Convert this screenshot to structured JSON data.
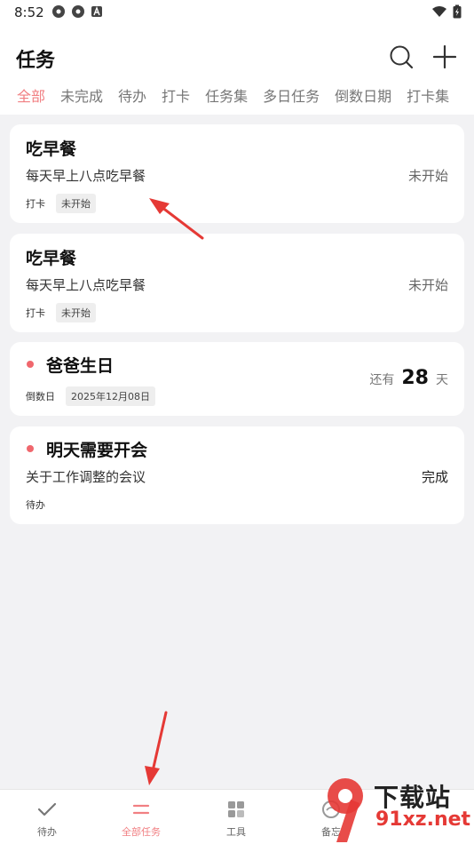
{
  "status_bar": {
    "time": "8:52"
  },
  "header": {
    "title": "任务",
    "search_icon": "search-icon",
    "add_icon": "plus-icon"
  },
  "tabs": [
    {
      "label": "全部",
      "active": true
    },
    {
      "label": "未完成",
      "active": false
    },
    {
      "label": "待办",
      "active": false
    },
    {
      "label": "打卡",
      "active": false
    },
    {
      "label": "任务集",
      "active": false
    },
    {
      "label": "多日任务",
      "active": false
    },
    {
      "label": "倒数日期",
      "active": false
    },
    {
      "label": "打卡集",
      "active": false
    }
  ],
  "cards": [
    {
      "title": "吃早餐",
      "desc": "每天早上八点吃早餐",
      "status": "未开始",
      "type_tag": "打卡",
      "state_tag": "未开始"
    },
    {
      "title": "吃早餐",
      "desc": "每天早上八点吃早餐",
      "status": "未开始",
      "type_tag": "打卡",
      "state_tag": "未开始"
    },
    {
      "title": "爸爸生日",
      "type_tag": "倒数日",
      "date_tag": "2025年12月08日",
      "countdown_prefix": "还有",
      "countdown_value": "28",
      "countdown_unit": "天"
    },
    {
      "title": "明天需要开会",
      "desc": "关于工作调整的会议",
      "status": "完成",
      "type_tag": "待办"
    }
  ],
  "bottom_nav": [
    {
      "label": "待办",
      "icon": "check-icon",
      "active": false
    },
    {
      "label": "全部任务",
      "icon": "list-icon",
      "active": true
    },
    {
      "label": "工具",
      "icon": "grid-icon",
      "active": false
    },
    {
      "label": "备忘",
      "icon": "memo-icon",
      "active": false
    }
  ],
  "watermark": {
    "top": "下载站",
    "bottom": "91xz.net"
  },
  "colors": {
    "accent": "#f17f82",
    "dot": "#f0676d",
    "arrow": "#e53935",
    "background": "#f2f2f4"
  }
}
